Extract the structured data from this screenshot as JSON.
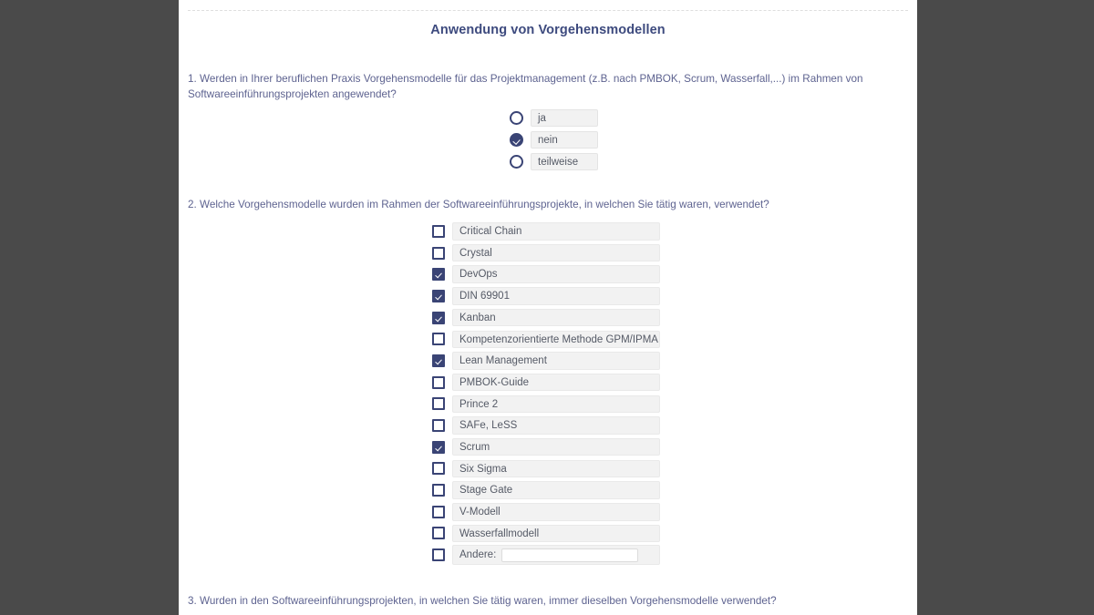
{
  "form": {
    "title": "Anwendung von Vorgehensmodellen"
  },
  "questions": {
    "q1": "1. Werden in Ihrer beruflichen Praxis Vorgehensmodelle für das Projektmanagement (z.B. nach PMBOK, Scrum, Wasserfall,...) im Rahmen von Softwareeinführungsprojekten angewendet?",
    "q2": "2. Welche Vorgehensmodelle wurden im Rahmen der Softwareeinführungsprojekte, in welchen Sie tätig waren, verwendet?",
    "q3": "3. Wurden in den Softwareeinführungsprojekten, in welchen Sie tätig waren, immer dieselben Vorgehensmodelle verwendet?"
  },
  "q1_options": [
    {
      "label": "ja",
      "selected": false
    },
    {
      "label": "nein",
      "selected": true
    },
    {
      "label": "teilweise",
      "selected": false
    }
  ],
  "q2_options": [
    {
      "label": "Critical Chain",
      "checked": false
    },
    {
      "label": "Crystal",
      "checked": false
    },
    {
      "label": "DevOps",
      "checked": true
    },
    {
      "label": "DIN 69901",
      "checked": true
    },
    {
      "label": "Kanban",
      "checked": true
    },
    {
      "label": "Kompetenzorientierte Methode GPM/IPMA ICB",
      "checked": false
    },
    {
      "label": "Lean Management",
      "checked": true
    },
    {
      "label": "PMBOK-Guide",
      "checked": false
    },
    {
      "label": "Prince 2",
      "checked": false
    },
    {
      "label": "SAFe, LeSS",
      "checked": false
    },
    {
      "label": "Scrum",
      "checked": true
    },
    {
      "label": "Six Sigma",
      "checked": false
    },
    {
      "label": "Stage Gate",
      "checked": false
    },
    {
      "label": "V-Modell",
      "checked": false
    },
    {
      "label": "Wasserfallmodell",
      "checked": false
    }
  ],
  "q2_other": {
    "label": "Andere:",
    "checked": false,
    "value": "",
    "placeholder": ""
  },
  "colors": {
    "accent": "#3a4475",
    "title": "#3d4a7e",
    "question_text": "#5e6390",
    "label_bg": "#f2f2f2",
    "page_bg": "#4a4a4a"
  }
}
